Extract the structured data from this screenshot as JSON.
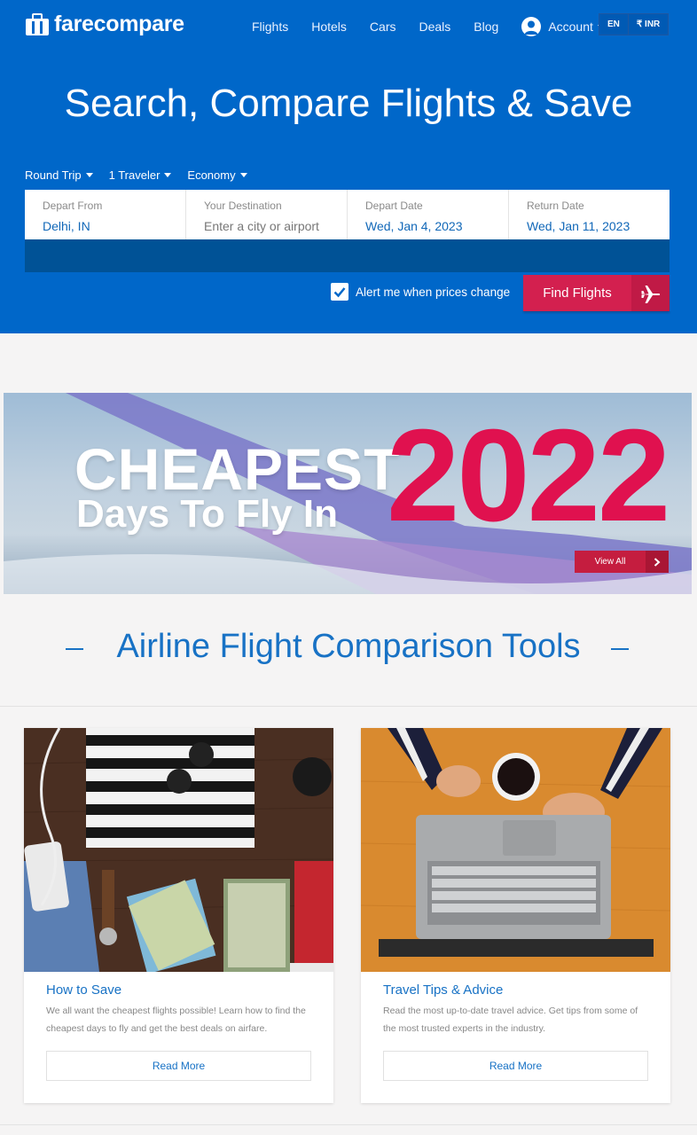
{
  "brand": {
    "name": "farecompare",
    "primary_color": "#0067c9",
    "accent_color": "#d3204f"
  },
  "nav": {
    "items": [
      {
        "label": "Flights"
      },
      {
        "label": "Hotels"
      },
      {
        "label": "Cars"
      },
      {
        "label": "Deals"
      },
      {
        "label": "Blog"
      }
    ],
    "account_label": "Account",
    "language": "EN",
    "currency": "₹ INR"
  },
  "hero": {
    "title": "Search, Compare Flights & Save",
    "trip_type": "Round Trip",
    "travelers": "1 Traveler",
    "cabin": "Economy",
    "fields": {
      "depart_from": {
        "label": "Depart From",
        "value": "Delhi, IN"
      },
      "destination": {
        "label": "Your Destination",
        "placeholder": "Enter a city or airport"
      },
      "depart_date": {
        "label": "Depart Date",
        "value": "Wed, Jan 4, 2023"
      },
      "return_date": {
        "label": "Return Date",
        "value": "Wed, Jan 11, 2023"
      }
    },
    "alert_label": "Alert me when prices change",
    "alert_checked": true,
    "find_button": "Find Flights"
  },
  "banner": {
    "line1": "CHEAPEST",
    "line2": "Days To Fly In",
    "year": "2022",
    "cta": "View All"
  },
  "section": {
    "title": "Airline Flight Comparison Tools"
  },
  "cards": [
    {
      "title": "How to Save",
      "desc": "We all want the cheapest flights possible! Learn how to find the cheapest days to fly and get the best deals on airfare.",
      "button": "Read More"
    },
    {
      "title": "Travel Tips & Advice",
      "desc": "Read the most up-to-date travel advice. Get tips from some of the most trusted experts in the industry.",
      "button": "Read More"
    }
  ]
}
